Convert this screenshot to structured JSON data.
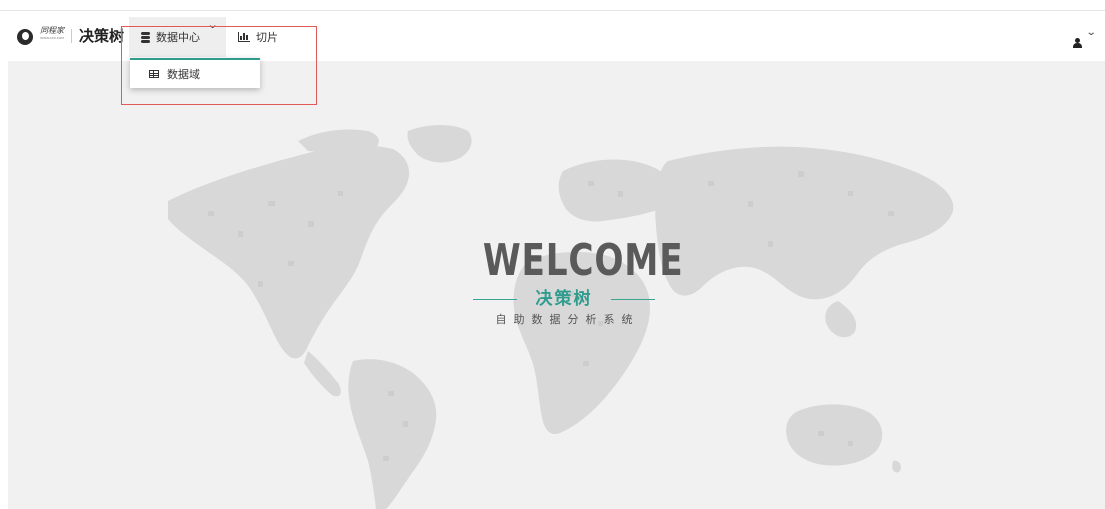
{
  "logo": {
    "brand": "同程家",
    "tagline": "WWW.XXX.COM"
  },
  "app_title": "决策树",
  "nav": {
    "data_center_label": "数据中心",
    "slice_label": "切片",
    "dropdown": {
      "items": [
        "数据域"
      ]
    }
  },
  "welcome": {
    "title": "WELCOME",
    "brand": "决策树",
    "subtitle": "自助数据分析系统"
  },
  "icons": [
    "logo-icon",
    "database-icon",
    "chevron-down-icon",
    "bar-chart-icon",
    "table-icon",
    "user-icon"
  ],
  "colors": {
    "accent": "#2f9c8e",
    "highlight_border": "#e05a5a",
    "content_bg": "#f1f1f1",
    "map": "#d6d6d6"
  }
}
